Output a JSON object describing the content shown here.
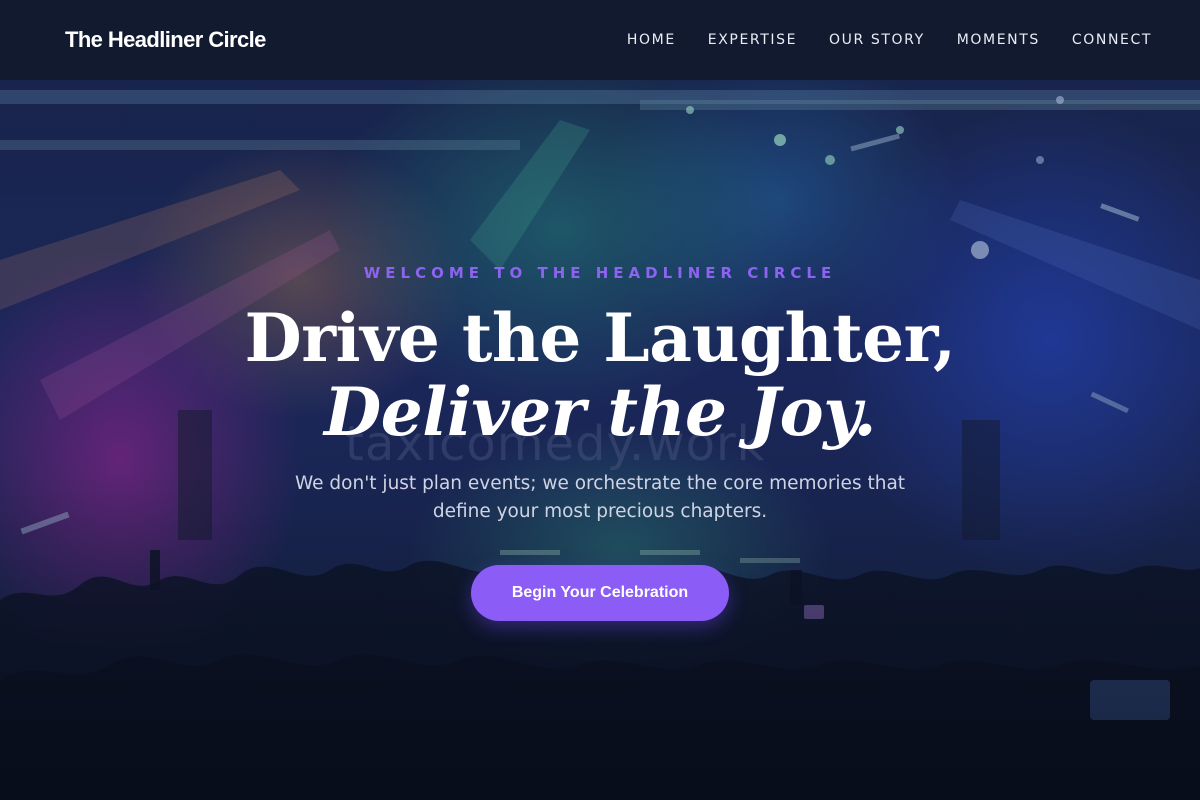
{
  "nav": {
    "brand": "The Headliner Circle",
    "links": [
      {
        "label": "HOME"
      },
      {
        "label": "EXPERTISE"
      },
      {
        "label": "OUR STORY"
      },
      {
        "label": "MOMENTS"
      },
      {
        "label": "CONNECT"
      }
    ]
  },
  "hero": {
    "eyebrow": "WELCOME TO THE HEADLINER CIRCLE",
    "headline_line1": "Drive the Laughter,",
    "headline_line2": "Deliver the Joy.",
    "watermark": "taxicomedy.work",
    "subtext": "We don't just plan events; we orchestrate the core memories that define your most precious chapters.",
    "cta_label": "Begin Your Celebration"
  },
  "colors": {
    "nav_bg": "#111a2e",
    "accent": "#8b5cf6",
    "eyebrow": "#8d63f0",
    "text": "#ffffff"
  }
}
